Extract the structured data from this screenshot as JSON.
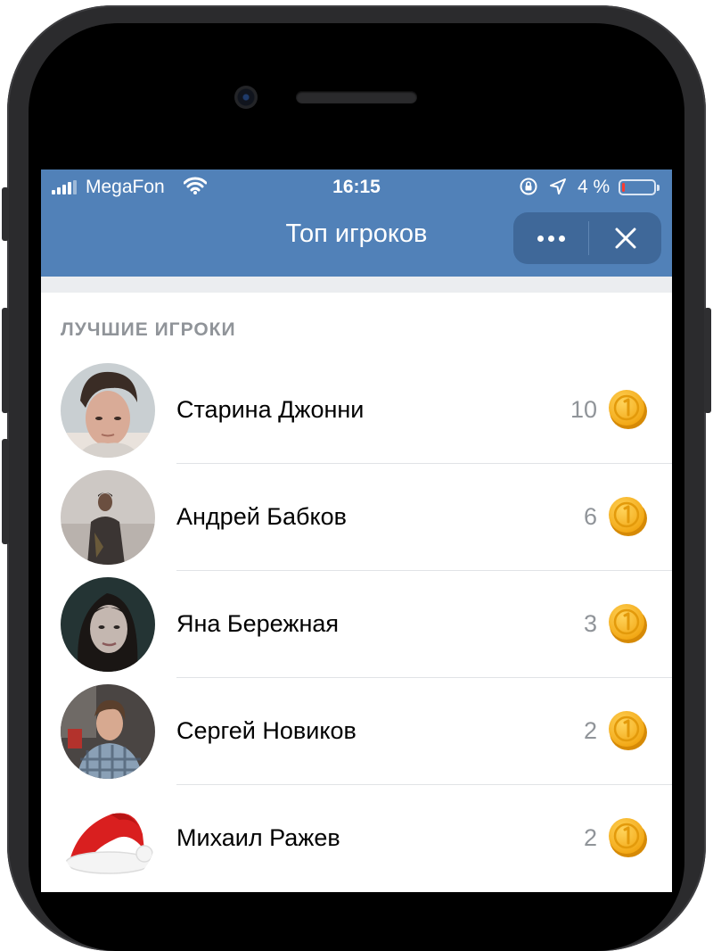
{
  "status_bar": {
    "carrier": "MegaFon",
    "time": "16:15",
    "battery_percent": "4 %",
    "battery_level": 0.04
  },
  "header": {
    "title": "Топ игроков",
    "more_icon": "more-dots-icon",
    "close_icon": "close-icon"
  },
  "section": {
    "title": "ЛУЧШИЕ ИГРОКИ"
  },
  "players": [
    {
      "name": "Старина Джонни",
      "score": "10"
    },
    {
      "name": "Андрей Бабков",
      "score": "6"
    },
    {
      "name": "Яна Бережная",
      "score": "3"
    },
    {
      "name": "Сергей Новиков",
      "score": "2"
    },
    {
      "name": "Михаил Ражев",
      "score": "2"
    }
  ],
  "colors": {
    "header_bg": "#5181b8",
    "coin": "#f5b11f",
    "secondary_text": "#909499"
  },
  "icons": {
    "coin": "coin-icon",
    "avatar": "avatar"
  }
}
